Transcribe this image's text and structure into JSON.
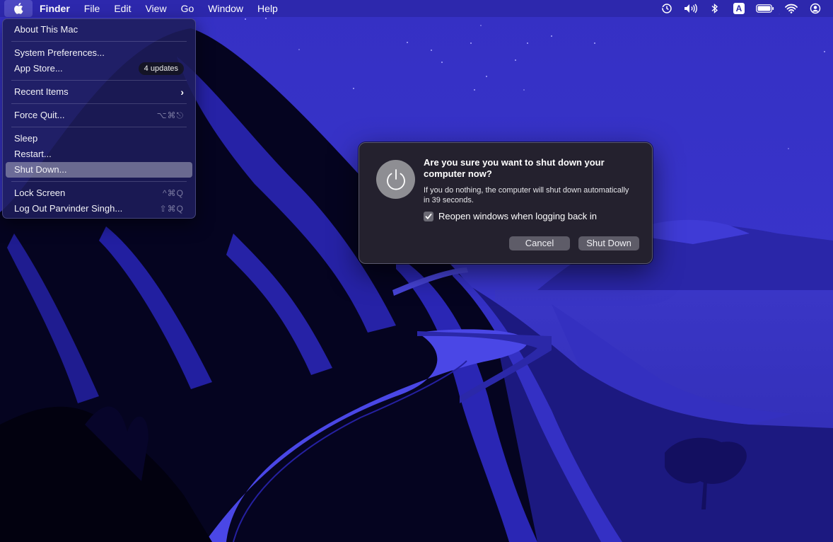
{
  "menubar": {
    "apple_icon": "apple-logo",
    "items": [
      "Finder",
      "File",
      "Edit",
      "View",
      "Go",
      "Window",
      "Help"
    ],
    "status_icons": [
      "time-machine-icon",
      "volume-icon",
      "bluetooth-icon",
      "input-source-icon",
      "battery-icon",
      "wifi-icon",
      "user-icon"
    ],
    "input_source_label": "A"
  },
  "apple_menu": {
    "items": [
      {
        "label": "About This Mac"
      },
      {
        "label": "System Preferences..."
      },
      {
        "label": "App Store...",
        "badge": "4 updates"
      },
      {
        "label": "Recent Items",
        "submenu": true
      },
      {
        "label": "Force Quit...",
        "shortcut": "⌥⌘⎋"
      },
      {
        "label": "Sleep"
      },
      {
        "label": "Restart..."
      },
      {
        "label": "Shut Down...",
        "selected": true
      },
      {
        "label": "Lock Screen",
        "shortcut": "^⌘Q"
      },
      {
        "label": "Log Out Parvinder Singh...",
        "shortcut": "⇧⌘Q"
      }
    ]
  },
  "dialog": {
    "icon": "power-icon",
    "title": "Are you sure you want to shut down your computer now?",
    "message": "If you do nothing, the computer will shut down automatically in 39 seconds.",
    "checkbox_label": "Reopen windows when logging back in",
    "checkbox_checked": true,
    "cancel_label": "Cancel",
    "confirm_label": "Shut Down"
  },
  "colors": {
    "menubar_bg": "#2c28aa",
    "sky": "#3a36c8",
    "dialog_bg": "#24212e",
    "button_bg": "#5e5c68",
    "selection": "#9d9db5"
  }
}
